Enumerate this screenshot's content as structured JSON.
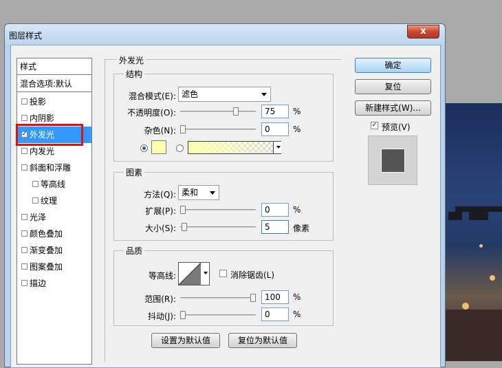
{
  "window": {
    "title": "图层样式",
    "close_glyph": "x"
  },
  "styles_panel": {
    "header": "样式",
    "blend_options": "混合选项:默认",
    "items": [
      {
        "label": "投影",
        "checked": false,
        "indent": false
      },
      {
        "label": "内阴影",
        "checked": false,
        "indent": false
      },
      {
        "label": "外发光",
        "checked": true,
        "indent": false,
        "selected": true
      },
      {
        "label": "内发光",
        "checked": false,
        "indent": false
      },
      {
        "label": "斜面和浮雕",
        "checked": false,
        "indent": false
      },
      {
        "label": "等高线",
        "checked": false,
        "indent": true
      },
      {
        "label": "纹理",
        "checked": false,
        "indent": true
      },
      {
        "label": "光泽",
        "checked": false,
        "indent": false
      },
      {
        "label": "颜色叠加",
        "checked": false,
        "indent": false
      },
      {
        "label": "渐变叠加",
        "checked": false,
        "indent": false
      },
      {
        "label": "图案叠加",
        "checked": false,
        "indent": false
      },
      {
        "label": "描边",
        "checked": false,
        "indent": false
      }
    ]
  },
  "outer_glow": {
    "section_title": "外发光",
    "structure": {
      "title": "结构",
      "blend_mode_label": "混合模式(E):",
      "blend_mode_value": "滤色",
      "opacity_label": "不透明度(O):",
      "opacity_value": "75",
      "opacity_fraction": 0.75,
      "noise_label": "杂色(N):",
      "noise_value": "0",
      "noise_fraction": 0,
      "unit": "%",
      "glow_color": "#ffffb0"
    },
    "elements": {
      "title": "图素",
      "technique_label": "方法(Q):",
      "technique_value": "柔和",
      "spread_label": "扩展(P):",
      "spread_value": "0",
      "spread_fraction": 0,
      "size_label": "大小(S):",
      "size_value": "5",
      "size_unit": "像素",
      "size_fraction": 0.02,
      "unit": "%"
    },
    "quality": {
      "title": "品质",
      "contour_label": "等高线:",
      "anti_alias_label": "消除锯齿(L)",
      "range_label": "范围(R):",
      "range_value": "100",
      "range_fraction": 1,
      "jitter_label": "抖动(J):",
      "jitter_value": "0",
      "jitter_fraction": 0,
      "unit": "%"
    },
    "set_default": "设置为默认值",
    "reset_default": "复位为默认值"
  },
  "buttons": {
    "ok": "确定",
    "reset": "复位",
    "new_style": "新建样式(W)...",
    "preview": "预览(V)"
  },
  "colors": {
    "selection": "#3399ff",
    "highlight_box": "#e01010",
    "preview_swatch": "#555555"
  }
}
